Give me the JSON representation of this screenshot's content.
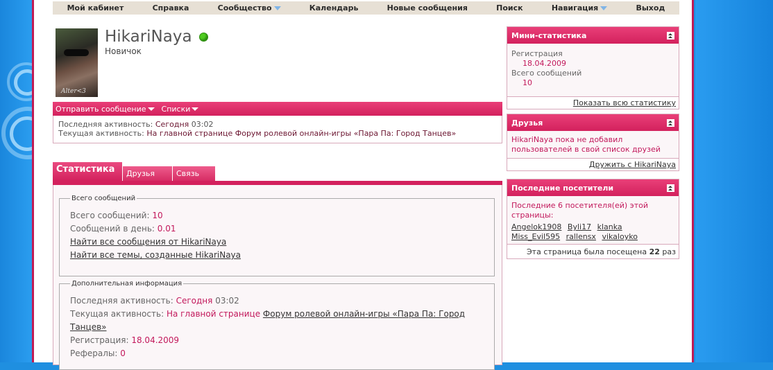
{
  "nav": {
    "items": [
      {
        "label": "Мой кабинет",
        "dropdown": false
      },
      {
        "label": "Справка",
        "dropdown": false
      },
      {
        "label": "Сообщество",
        "dropdown": true
      },
      {
        "label": "Календарь",
        "dropdown": false
      },
      {
        "label": "Новые сообщения",
        "dropdown": false
      },
      {
        "label": "Поиск",
        "dropdown": false
      },
      {
        "label": "Навигация",
        "dropdown": true
      },
      {
        "label": "Выход",
        "dropdown": false
      }
    ]
  },
  "profile": {
    "username": "HikariNaya",
    "rank": "Новичок",
    "avatar_signature": "Alter<3",
    "actions": {
      "send_message": "Отправить сообщение",
      "lists": "Списки"
    },
    "activity": {
      "last_label": "Последняя активность:",
      "last_value": "Сегодня",
      "last_time": "03:02",
      "current_label": "Текущая активность:",
      "current_value": "На главной странице Форум ролевой онлайн-игры «Пара Па: Город Танцев»"
    }
  },
  "tabs": {
    "stats": "Статистика",
    "friends": "Друзья",
    "contact": "Связь"
  },
  "stats": {
    "posts_legend": "Всего сообщений",
    "total_label": "Всего сообщений:",
    "total_value": "10",
    "per_day_label": "Сообщений в день:",
    "per_day_value": "0.01",
    "find_posts": "Найти все сообщения от HikariNaya",
    "find_threads": "Найти все темы, созданные HikariNaya",
    "extra_legend": "Дополнительная информация",
    "last_label": "Последняя активность:",
    "last_value": "Сегодня",
    "last_time": "03:02",
    "current_label": "Текущая активность:",
    "current_value": "На главной странице",
    "current_link": "Форум ролевой онлайн-игры «Пара Па: Город Танцев»",
    "reg_label": "Регистрация:",
    "reg_value": "18.04.2009",
    "ref_label": "Рефералы:",
    "ref_value": "0"
  },
  "sidebar": {
    "mini": {
      "title": "Мини-статистика",
      "reg_label": "Регистрация",
      "reg_value": "18.04.2009",
      "posts_label": "Всего сообщений",
      "posts_value": "10",
      "footer": "Показать всю статистику"
    },
    "friends": {
      "title": "Друзья",
      "text": "HikariNaya пока не добавил пользователей в свой список друзей",
      "footer": "Дружить с HikariNaya"
    },
    "visitors": {
      "title": "Последние посетители",
      "text": "Последние 6 посетителя(ей) этой страницы:",
      "names": [
        "Angelok1908",
        "Byli17",
        "klanka",
        "Miss_Evil595",
        "rallensx",
        "vikaloyko"
      ],
      "footer_prefix": "Эта страница была посещена",
      "footer_count": "22",
      "footer_suffix": "раз"
    }
  }
}
